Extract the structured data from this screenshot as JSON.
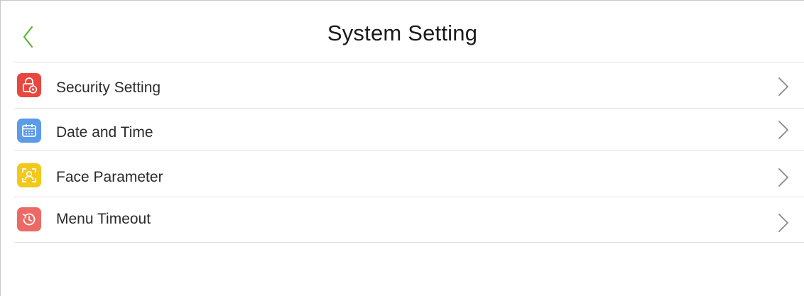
{
  "header": {
    "title": "System Setting",
    "back_icon": "chevron-left-icon"
  },
  "menu": {
    "items": [
      {
        "label": "Security Setting",
        "icon": "lock-gear-icon",
        "icon_color": "#e8473f"
      },
      {
        "label": "Date and Time",
        "icon": "calendar-icon",
        "icon_color": "#5b9be8"
      },
      {
        "label": "Face Parameter",
        "icon": "face-scan-icon",
        "icon_color": "#f2c81c"
      },
      {
        "label": "Menu Timeout",
        "icon": "history-clock-icon",
        "icon_color": "#ec6a66"
      }
    ]
  },
  "colors": {
    "accent": "#5cb531",
    "chevron": "#8a8a8a"
  }
}
